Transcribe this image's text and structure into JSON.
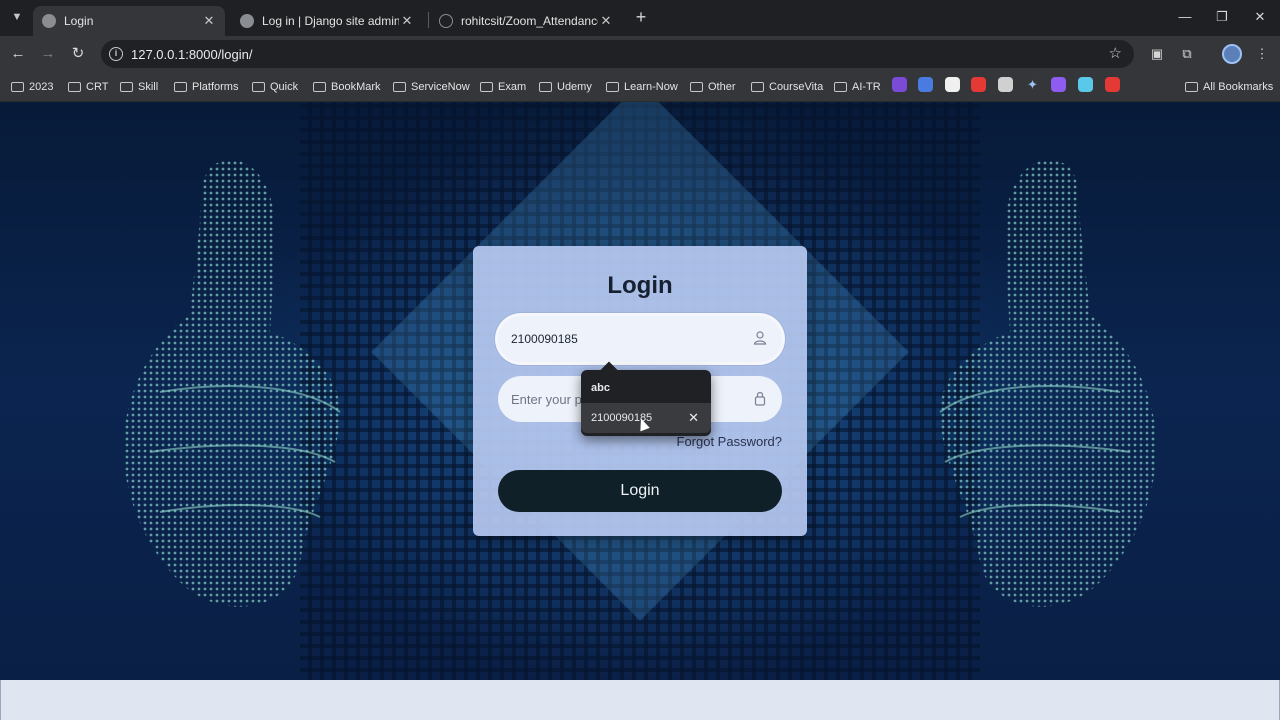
{
  "browser": {
    "tabs": [
      {
        "title": "Login",
        "active": true
      },
      {
        "title": "Log in | Django site admin",
        "active": false
      },
      {
        "title": "rohitcsit/Zoom_Attendance_Tra",
        "active": false
      }
    ],
    "url": "127.0.0.1:8000/login/",
    "bookmarks": [
      "2023",
      "CRT",
      "Skill",
      "Platforms",
      "Quick",
      "BookMark",
      "ServiceNow",
      "Exam",
      "Udemy",
      "Learn-Now",
      "Other",
      "CourseVita",
      "AI-TR"
    ],
    "all_bookmarks": "All Bookmarks",
    "bookmark_icon_colors": [
      "#7b4bd8",
      "#4a7be0",
      "#f0f0f0",
      "#e53935",
      "#d0d0d0",
      "#8e5cf0",
      "#5ac8e8",
      "#e53935"
    ]
  },
  "login": {
    "title": "Login",
    "username_value": "2100090185",
    "password_placeholder": "Enter your p",
    "forgot_password": "Forgot Password?",
    "button": "Login"
  },
  "autofill": {
    "items": [
      "abc",
      "2100090185"
    ]
  }
}
